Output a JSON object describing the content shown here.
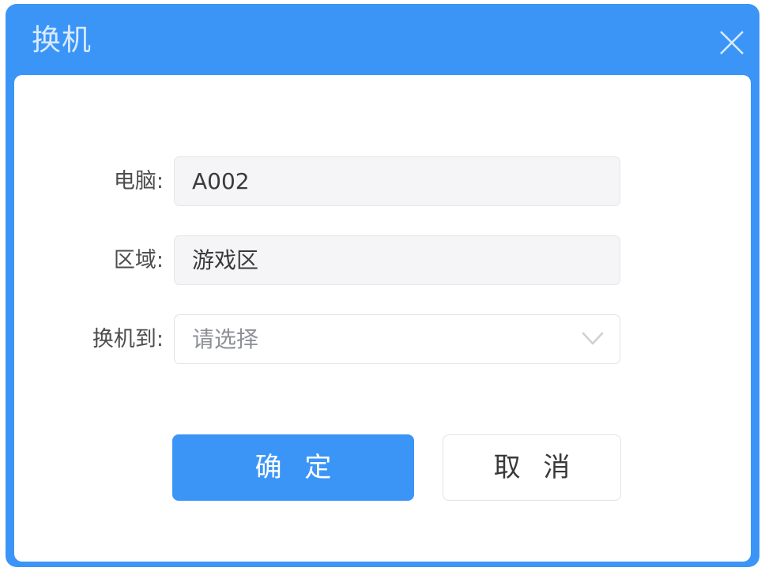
{
  "dialog": {
    "title": "换机",
    "close_icon": "close-icon",
    "accent_color": "#3b95f7",
    "title_color": "#ffffff",
    "panel_background": "#ffffff"
  },
  "form": {
    "fields": [
      {
        "label": "电脑:",
        "value": "A002",
        "type": "readonly-input",
        "name": "computer"
      },
      {
        "label": "区域:",
        "value": "游戏区",
        "type": "readonly-input",
        "name": "area"
      },
      {
        "label": "换机到:",
        "value": "请选择",
        "placeholder": "请选择",
        "type": "select",
        "name": "transfer-to",
        "arrow_icon": "chevron-down-icon"
      }
    ]
  },
  "footer": {
    "confirm_label": "确 定",
    "cancel_label": "取 消"
  }
}
